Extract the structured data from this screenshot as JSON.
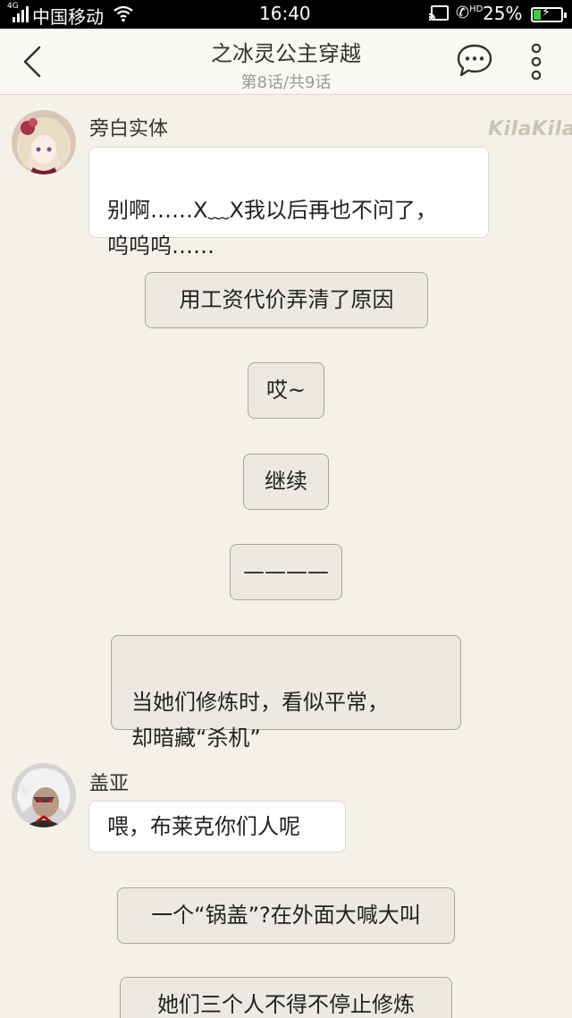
{
  "status_bar": {
    "network": "4G",
    "carrier": "中国移动",
    "time": "16:40",
    "call_badge": "HD",
    "battery_percent": "25%",
    "battery_level": 0.25
  },
  "header": {
    "title": "之冰灵公主穿越",
    "subtitle": "第8话/共9话"
  },
  "watermark": "KilaKila",
  "messages": [
    {
      "type": "character",
      "speaker": "旁白实体",
      "text": "别啊……X﹏X我以后再也不问了，\n呜呜呜……"
    },
    {
      "type": "narration",
      "text": "用工资代价弄清了原因"
    },
    {
      "type": "narration",
      "text": "哎~"
    },
    {
      "type": "narration",
      "text": "继续"
    },
    {
      "type": "narration",
      "text": "————"
    },
    {
      "type": "narration",
      "text": "当她们修炼时，看似平常，\n却暗藏“杀机”"
    },
    {
      "type": "character",
      "speaker": "盖亚",
      "text": "喂，布莱克你们人呢"
    },
    {
      "type": "narration",
      "text": "一个“锅盖”?在外面大喊大叫"
    },
    {
      "type": "narration",
      "text": "她们三个人不得不停止修炼"
    }
  ],
  "colors": {
    "background": "#f4f1e8",
    "bubble_white": "#ffffff",
    "bubble_gray": "#ebe9e2",
    "battery_fill": "#3ccf3c"
  }
}
